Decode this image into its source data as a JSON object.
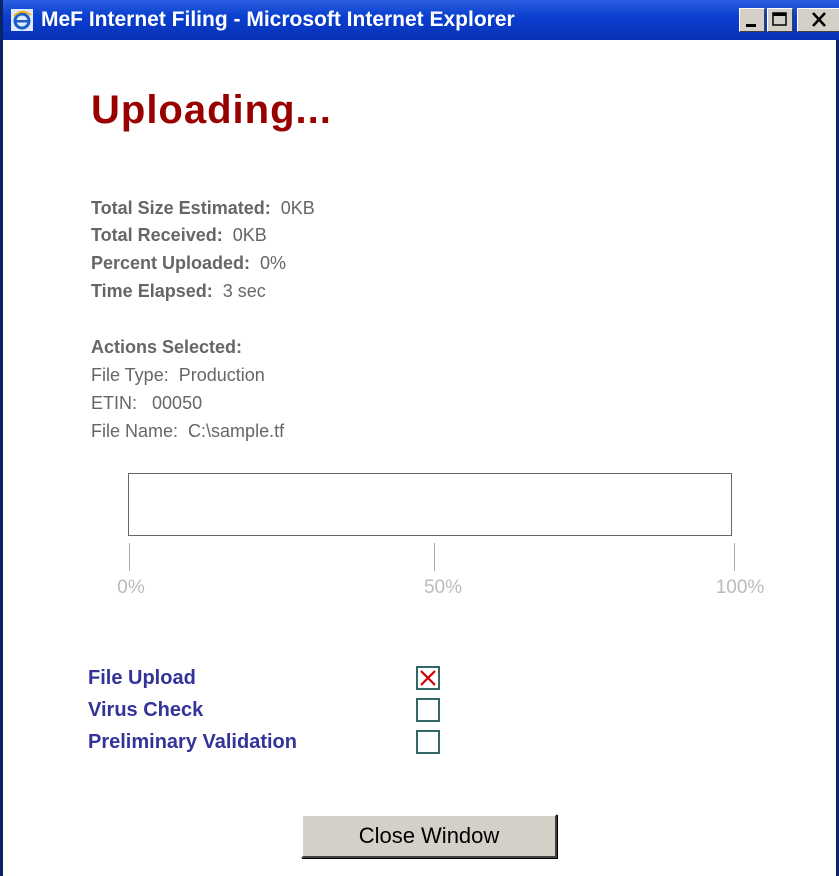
{
  "window": {
    "title": "MeF Internet Filing - Microsoft Internet Explorer"
  },
  "page": {
    "heading": "Uploading..."
  },
  "stats": [
    {
      "label": "Total Size Estimated:",
      "value": "0KB"
    },
    {
      "label": "Total Received:",
      "value": "0KB"
    },
    {
      "label": "Percent Uploaded:",
      "value": "0%"
    },
    {
      "label": "Time Elapsed:",
      "value": "3 sec"
    }
  ],
  "actions": {
    "heading": "Actions Selected:",
    "items": [
      {
        "label": "File Type:",
        "value": "Production"
      },
      {
        "label": "ETIN:",
        "value": "00050"
      },
      {
        "label": "File Name:",
        "value": "C:\\sample.tf"
      }
    ]
  },
  "progress": {
    "percent": 0,
    "ticks": [
      "0%",
      "50%",
      "100%"
    ],
    "fill_color": "#3366cc"
  },
  "steps": [
    {
      "label": "File Upload",
      "status": "failed"
    },
    {
      "label": "Virus Check",
      "status": "pending"
    },
    {
      "label": "Preliminary Validation",
      "status": "pending"
    }
  ],
  "close_button": {
    "label": "Close Window"
  },
  "colors": {
    "heading": "#990000",
    "stat_text": "#666666",
    "step_label": "#333399",
    "failed_mark": "#cc0000",
    "titlebar": "#0a3fd0"
  },
  "icons": {
    "app": "ie-icon",
    "minimize": "minimize-icon",
    "maximize": "maximize-icon",
    "close": "close-icon",
    "failed": "x-mark-icon"
  }
}
